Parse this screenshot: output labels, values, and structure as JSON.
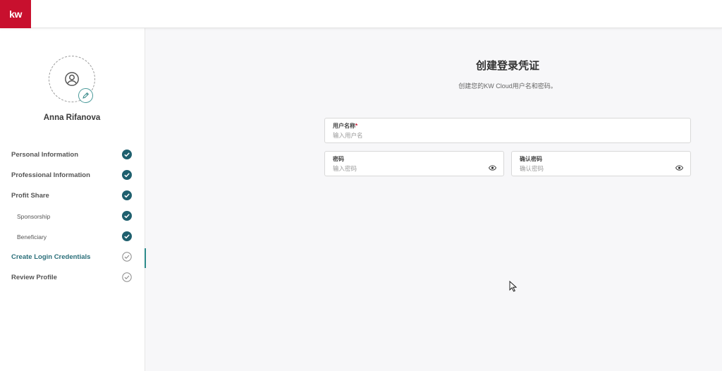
{
  "brand": {
    "logo_text": "kw",
    "color": "#c8102e"
  },
  "sidebar": {
    "user_name": "Anna Rifanova",
    "steps": [
      {
        "label": "Personal Information",
        "status": "complete"
      },
      {
        "label": "Professional Information",
        "status": "complete"
      },
      {
        "label": "Profit Share",
        "status": "complete"
      },
      {
        "label": "Sponsorship",
        "status": "complete"
      },
      {
        "label": "Beneficiary",
        "status": "complete"
      },
      {
        "label": "Create Login Credentials",
        "status": "current"
      },
      {
        "label": "Review Profile",
        "status": "pending"
      }
    ]
  },
  "main": {
    "title": "创建登录凭证",
    "subtitle": "创建您的KW Cloud用户名和密码。",
    "fields": {
      "username": {
        "label": "用户名称",
        "required_mark": "*",
        "placeholder": "输入用户名",
        "value": ""
      },
      "password": {
        "label": "密码",
        "placeholder": "输入密码",
        "value": ""
      },
      "confirm_password": {
        "label": "确认密码",
        "placeholder": "确认密码",
        "value": ""
      }
    }
  },
  "colors": {
    "accent_teal": "#1e5f6e",
    "active_text": "#2b6f7a",
    "pending_gray": "#8a8a8a"
  }
}
